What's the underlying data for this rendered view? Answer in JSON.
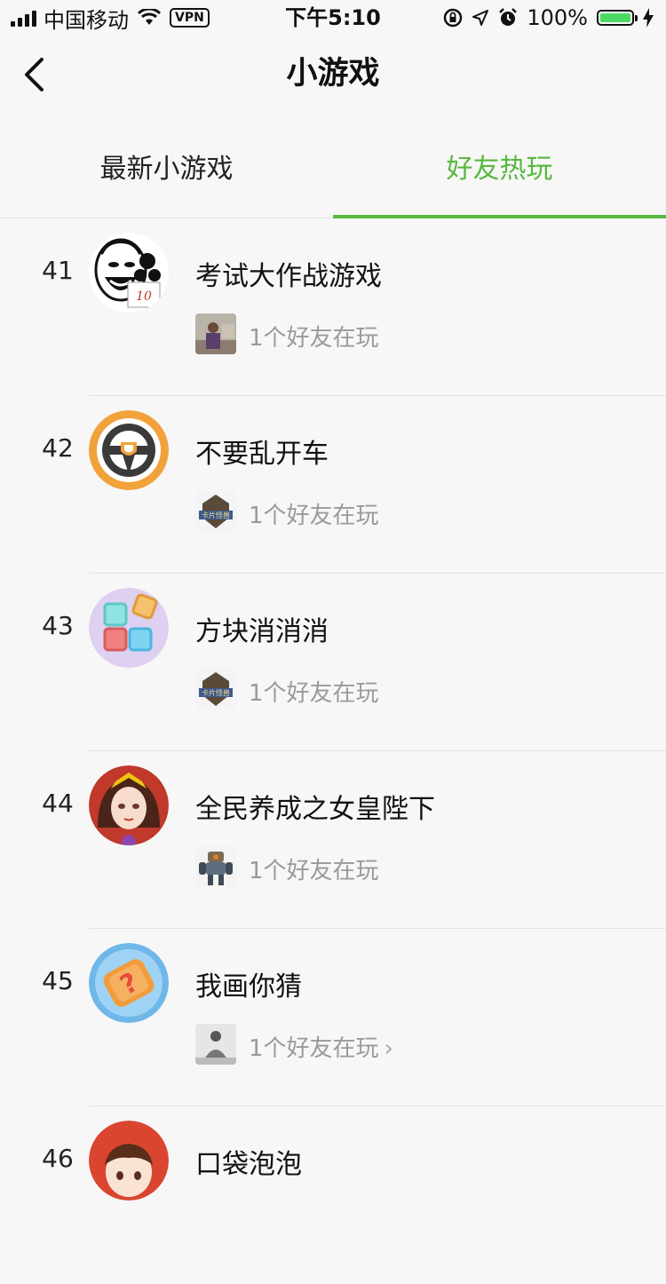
{
  "status_bar": {
    "carrier": "中国移动",
    "vpn": "VPN",
    "time": "下午5:10",
    "battery": "100%",
    "battery_level": 1.0
  },
  "nav": {
    "title": "小游戏"
  },
  "tabs": [
    {
      "label": "最新小游戏",
      "active": false
    },
    {
      "label": "好友热玩",
      "active": true
    }
  ],
  "colors": {
    "accent": "#57b83e",
    "muted_text": "#9a9a9a"
  },
  "games": [
    {
      "rank": "41",
      "name": "考试大作战游戏",
      "friends": "1个好友在玩",
      "icon": "meme-face-icon",
      "friend_icon": "friend-photo-icon",
      "chevron": false
    },
    {
      "rank": "42",
      "name": "不要乱开车",
      "friends": "1个好友在玩",
      "icon": "steering-wheel-icon",
      "friend_icon": "card-monster-badge-icon",
      "chevron": false
    },
    {
      "rank": "43",
      "name": "方块消消消",
      "friends": "1个好友在玩",
      "icon": "colored-blocks-icon",
      "friend_icon": "card-monster-badge-icon",
      "chevron": false
    },
    {
      "rank": "44",
      "name": "全民养成之女皇陛下",
      "friends": "1个好友在玩",
      "icon": "empress-portrait-icon",
      "friend_icon": "robot-icon",
      "chevron": false
    },
    {
      "rank": "45",
      "name": "我画你猜",
      "friends": "1个好友在玩",
      "icon": "question-card-icon",
      "friend_icon": "friend-photo-bw-icon",
      "chevron": true
    },
    {
      "rank": "46",
      "name": "口袋泡泡",
      "friends": "",
      "icon": "red-hood-girl-icon",
      "friend_icon": "",
      "chevron": false
    }
  ],
  "chevron_glyph": "›"
}
